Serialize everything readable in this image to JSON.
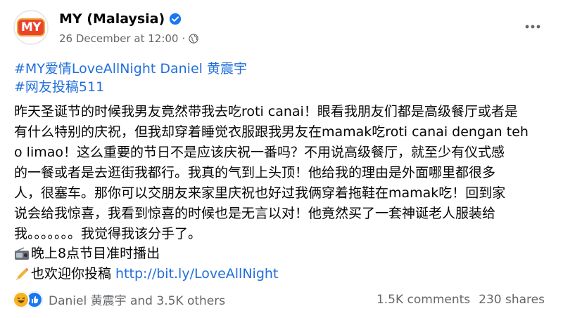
{
  "page": {
    "name": "MY (Malaysia)",
    "logo_text": "MY",
    "date": "26 December at 12:00",
    "separator": "·"
  },
  "post": {
    "hashtags": [
      "#MY爱情LoveAllNight Daniel 黄震宇",
      "#网友投稿511"
    ],
    "body_lines": [
      "昨天圣诞节的时候我男友竟然带我去吃roti canai！眼看我朋友们都是高级餐厅或者是",
      "有什么特别的庆祝，但我却穿着睡觉衣服跟我男友在mamak吃roti canai dengan teh",
      "o limao！这么重要的节日不是应该庆祝一番吗？不用说高级餐厅，就至少有仪式感",
      "的一餐或者是去逛街我都行。我真的气到上头顶！他给我的理由是外面哪里都很多",
      "人，很塞车。那你可以交朋友来家里庆祝也好过我俩穿着拖鞋在mamak吃！回到家",
      "说会给我惊喜，我看到惊喜的时候也是无言以对！他竟然买了一套神诞老人服装给",
      "我。。。。。。。我觉得我该分手了。"
    ],
    "broadcast_text": "晚上8点节目准时播出",
    "submit_text": "也欢迎你投稿",
    "submit_link": "http://bit.ly/LoveAllNight"
  },
  "footer": {
    "reactors": "Daniel 黄震宇 and 3.5K others",
    "comments": "1.5K comments",
    "shares": "230 shares"
  },
  "colors": {
    "link": "#216fdb",
    "secondary_text": "#65676b",
    "verified": "#1877f2",
    "brand": "#e8452c"
  },
  "icons": [
    "verified-badge-icon",
    "globe-icon",
    "more-options-icon",
    "radio-icon",
    "pencil-icon",
    "haha-reaction-icon",
    "like-reaction-icon"
  ]
}
